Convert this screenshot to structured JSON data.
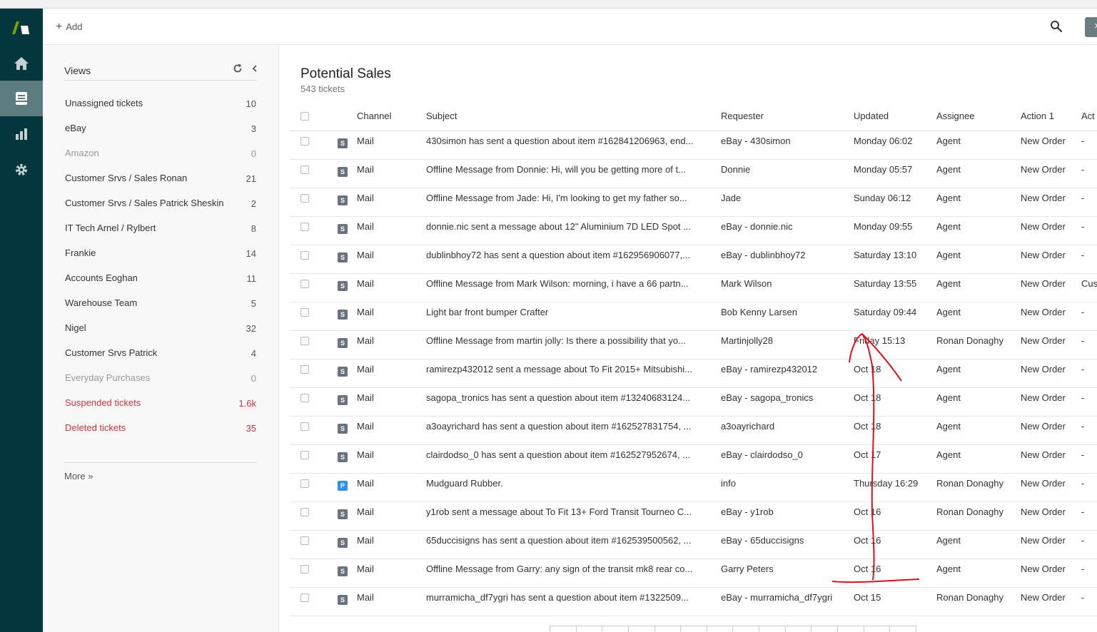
{
  "topbar": {
    "add_label": "Add"
  },
  "nav": {
    "items": [
      "home-icon",
      "tickets-icon",
      "reports-icon",
      "admin-gear-icon"
    ],
    "active": "tickets-icon"
  },
  "views": {
    "title": "Views",
    "items": [
      {
        "label": "Unassigned tickets",
        "count": "10",
        "style": "normal"
      },
      {
        "label": "eBay",
        "count": "3",
        "style": "normal"
      },
      {
        "label": "Amazon",
        "count": "0",
        "style": "muted"
      },
      {
        "label": "Customer Srvs / Sales Ronan",
        "count": "21",
        "style": "normal"
      },
      {
        "label": "Customer Srvs / Sales Patrick Sheskin",
        "count": "2",
        "style": "normal"
      },
      {
        "label": "IT Tech Arnel / Rylbert",
        "count": "8",
        "style": "normal"
      },
      {
        "label": "Frankie",
        "count": "14",
        "style": "normal"
      },
      {
        "label": "Accounts Eoghan",
        "count": "11",
        "style": "normal"
      },
      {
        "label": "Warehouse Team",
        "count": "5",
        "style": "normal"
      },
      {
        "label": "Nigel",
        "count": "32",
        "style": "normal"
      },
      {
        "label": "Customer Srvs Patrick",
        "count": "4",
        "style": "normal"
      },
      {
        "label": "Everyday Purchases",
        "count": "0",
        "style": "muted"
      },
      {
        "label": "Suspended tickets",
        "count": "1.6k",
        "style": "red"
      },
      {
        "label": "Deleted tickets",
        "count": "35",
        "style": "red"
      }
    ],
    "more_label": "More »"
  },
  "main": {
    "title": "Potential Sales",
    "subtitle": "543 tickets",
    "columns": [
      "Channel",
      "Subject",
      "Requester",
      "Updated",
      "Assignee",
      "Action 1",
      "Act"
    ],
    "rows": [
      {
        "status": "S",
        "channel": "Mail",
        "subject": "430simon has sent a question about item #162841206963, end...",
        "requester": "eBay - 430simon",
        "updated": "Monday 06:02",
        "assignee": "Agent",
        "action1": "New Order",
        "action2": "-"
      },
      {
        "status": "S",
        "channel": "Mail",
        "subject": "Offline Message from Donnie: Hi, will you be getting more of t...",
        "requester": "Donnie",
        "updated": "Monday 05:57",
        "assignee": "Agent",
        "action1": "New Order",
        "action2": "-"
      },
      {
        "status": "S",
        "channel": "Mail",
        "subject": "Offline Message from Jade: Hi, I'm looking to get my father so...",
        "requester": "Jade",
        "updated": "Sunday 06:12",
        "assignee": "Agent",
        "action1": "New Order",
        "action2": "-"
      },
      {
        "status": "S",
        "channel": "Mail",
        "subject": "donnie.nic sent a message about 12\" Aluminium 7D LED Spot ...",
        "requester": "eBay - donnie.nic",
        "updated": "Monday 09:55",
        "assignee": "Agent",
        "action1": "New Order",
        "action2": "-"
      },
      {
        "status": "S",
        "channel": "Mail",
        "subject": "dublinbhoy72 has sent a question about item #162956906077,...",
        "requester": "eBay - dublinbhoy72",
        "updated": "Saturday 13:10",
        "assignee": "Agent",
        "action1": "New Order",
        "action2": "-"
      },
      {
        "status": "S",
        "channel": "Mail",
        "subject": "Offline Message from Mark Wilson: morning, i have a 66 partn...",
        "requester": "Mark Wilson",
        "updated": "Saturday 13:55",
        "assignee": "Agent",
        "action1": "New Order",
        "action2": "Cus"
      },
      {
        "status": "S",
        "channel": "Mail",
        "subject": "Light bar front bumper Crafter",
        "requester": "Bob Kenny Larsen",
        "updated": "Saturday 09:44",
        "assignee": "Agent",
        "action1": "New Order",
        "action2": "-"
      },
      {
        "status": "S",
        "channel": "Mail",
        "subject": "Offline Message from martin jolly: Is there a possibility that yo...",
        "requester": "Martinjolly28",
        "updated": "Friday 15:13",
        "assignee": "Ronan Donaghy",
        "action1": "New Order",
        "action2": "-"
      },
      {
        "status": "S",
        "channel": "Mail",
        "subject": "ramirezp432012 sent a message about To Fit 2015+ Mitsubishi...",
        "requester": "eBay - ramirezp432012",
        "updated": "Oct 18",
        "assignee": "Agent",
        "action1": "New Order",
        "action2": "-"
      },
      {
        "status": "S",
        "channel": "Mail",
        "subject": "sagopa_tronics has sent a question about item #13240683124...",
        "requester": "eBay - sagopa_tronics",
        "updated": "Oct 18",
        "assignee": "Agent",
        "action1": "New Order",
        "action2": "-"
      },
      {
        "status": "S",
        "channel": "Mail",
        "subject": "a3oayrichard has sent a question about item #162527831754, ...",
        "requester": "a3oayrichard",
        "updated": "Oct 18",
        "assignee": "Agent",
        "action1": "New Order",
        "action2": "-"
      },
      {
        "status": "S",
        "channel": "Mail",
        "subject": "clairdodso_0 has sent a question about item #162527952674, ...",
        "requester": "eBay - clairdodso_0",
        "updated": "Oct 17",
        "assignee": "Agent",
        "action1": "New Order",
        "action2": "-"
      },
      {
        "status": "P",
        "channel": "Mail",
        "subject": "Mudguard Rubber.",
        "requester": "info",
        "updated": "Thursday 16:29",
        "assignee": "Ronan Donaghy",
        "action1": "New Order",
        "action2": "-"
      },
      {
        "status": "S",
        "channel": "Mail",
        "subject": "y1rob sent a message about To Fit 13+ Ford Transit Tourneo C...",
        "requester": "eBay - y1rob",
        "updated": "Oct 16",
        "assignee": "Ronan Donaghy",
        "action1": "New Order",
        "action2": "-"
      },
      {
        "status": "S",
        "channel": "Mail",
        "subject": "65duccisigns has sent a question about item #162539500562, ...",
        "requester": "eBay - 65duccisigns",
        "updated": "Oct 16",
        "assignee": "Agent",
        "action1": "New Order",
        "action2": "-"
      },
      {
        "status": "S",
        "channel": "Mail",
        "subject": "Offline Message from Garry: any sign of the transit mk8 rear co...",
        "requester": "Garry Peters",
        "updated": "Oct 16",
        "assignee": "Agent",
        "action1": "New Order",
        "action2": "-"
      },
      {
        "status": "S",
        "channel": "Mail",
        "subject": "murramicha_df7ygri has sent a question about item #1322509...",
        "requester": "eBay - murramicha_df7ygri",
        "updated": "Oct 15",
        "assignee": "Ronan Donaghy",
        "action1": "New Order",
        "action2": "-"
      }
    ]
  },
  "colors": {
    "rail": "#03363d",
    "rail_active": "#5d7c80",
    "red_view": "#cc3340",
    "annotation": "#e0101a"
  }
}
